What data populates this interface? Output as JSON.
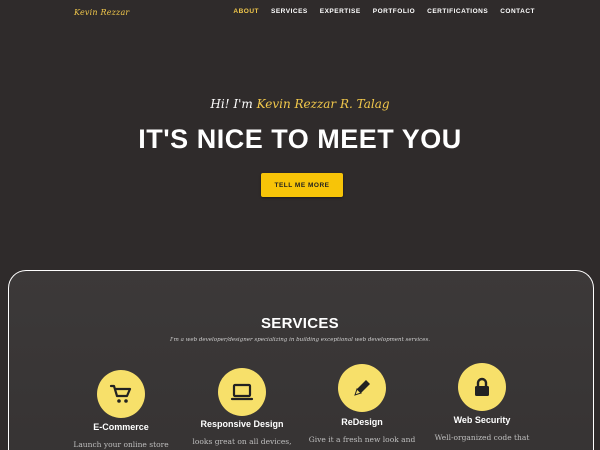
{
  "navbar": {
    "brand": "Kevin Rezzar",
    "links": [
      "ABOUT",
      "SERVICES",
      "EXPERTISE",
      "PORTFOLIO",
      "CERTIFICATIONS",
      "CONTACT"
    ],
    "active": "ABOUT"
  },
  "hero": {
    "greeting_prefix": "Hi! I'm ",
    "greeting_name": "Kevin Rezzar R. Talag",
    "title": "IT'S NICE TO MEET YOU",
    "cta_label": "TELL ME MORE"
  },
  "services": {
    "title": "SERVICES",
    "subtitle": "I'm a web developer/designer specializing in building exceptional web development services.",
    "items": [
      {
        "icon": "shopping-cart-icon",
        "name": "E-Commerce",
        "desc": "Launch your online store"
      },
      {
        "icon": "laptop-icon",
        "name": "Responsive Design",
        "desc": "looks great on all devices,"
      },
      {
        "icon": "pencil-icon",
        "name": "ReDesign",
        "desc": "Give it a fresh new look and"
      },
      {
        "icon": "lock-icon",
        "name": "Web Security",
        "desc": "Well-organized code that"
      }
    ]
  },
  "colors": {
    "background": "#2f2b2b",
    "accent": "#f7c408",
    "icon_circle": "#f7e06a",
    "brand_text": "#f2c84b"
  }
}
